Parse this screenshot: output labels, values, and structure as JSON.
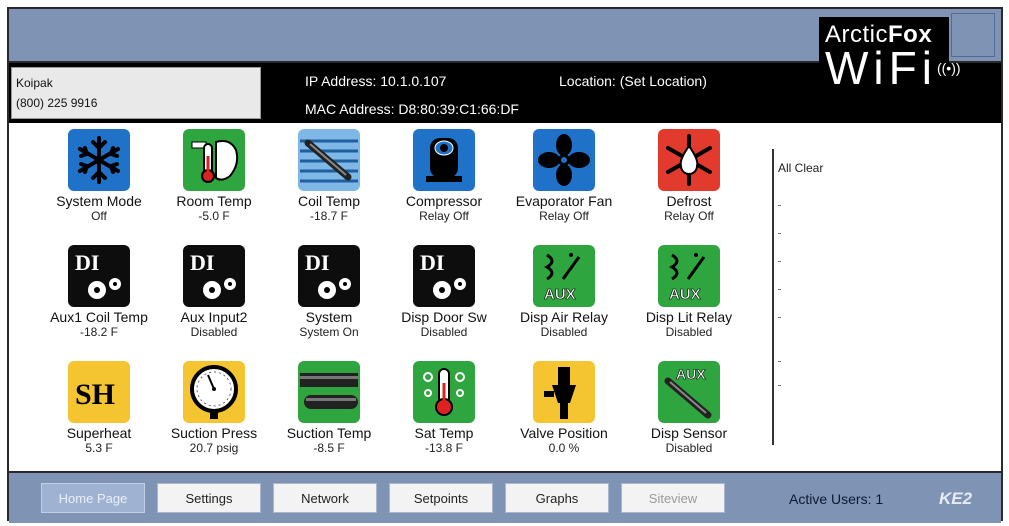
{
  "header": {
    "contact_name": "Koipak",
    "contact_phone": "(800) 225 9916",
    "ip_address": "IP Address: 10.1.0.107",
    "mac_address": "MAC Address: D8:80:39:C1:66:DF",
    "location": "Location: (Set Location)",
    "logo_arctic": "Arctic",
    "logo_fox": "Fox",
    "logo_wifi": "WiFi",
    "status_color": "#f6d90c"
  },
  "tiles": [
    {
      "label": "System Mode",
      "value": "Off",
      "icon": "snowflake-icon"
    },
    {
      "label": "Room Temp",
      "value": "-5.0 F",
      "icon": "room-thermometer-icon"
    },
    {
      "label": "Coil Temp",
      "value": "-18.7 F",
      "icon": "coil-sensor-icon"
    },
    {
      "label": "Compressor",
      "value": "Relay Off",
      "icon": "compressor-icon"
    },
    {
      "label": "Evaporator Fan",
      "value": "Relay Off",
      "icon": "fan-icon"
    },
    {
      "label": "Defrost",
      "value": "Relay Off",
      "icon": "defrost-icon"
    },
    {
      "label": "Aux1 Coil Temp",
      "value": "-18.2 F",
      "icon": "di-gear-icon"
    },
    {
      "label": "Aux Input2",
      "value": "Disabled",
      "icon": "di-gear-icon"
    },
    {
      "label": "System",
      "value": "System On",
      "icon": "di-gear-icon"
    },
    {
      "label": "Disp Door Sw",
      "value": "Disabled",
      "icon": "di-gear-icon"
    },
    {
      "label": "Disp Air Relay",
      "value": "Disabled",
      "icon": "aux-relay-icon"
    },
    {
      "label": "Disp Lit Relay",
      "value": "Disabled",
      "icon": "aux-relay-icon"
    },
    {
      "label": "Superheat",
      "value": "5.3 F",
      "icon": "superheat-icon"
    },
    {
      "label": "Suction Press",
      "value": "20.7 psig",
      "icon": "pressure-gauge-icon"
    },
    {
      "label": "Suction Temp",
      "value": "-8.5 F",
      "icon": "pipe-sensor-icon"
    },
    {
      "label": "Sat Temp",
      "value": "-13.8 F",
      "icon": "sat-thermometer-icon"
    },
    {
      "label": "Valve Position",
      "value": "0.0 %",
      "icon": "valve-icon"
    },
    {
      "label": "Disp Sensor",
      "value": "Disabled",
      "icon": "aux-sensor-icon"
    }
  ],
  "icon_text": {
    "di": "DI",
    "aux": "AUX",
    "sh": "SH"
  },
  "alarms": {
    "title": "All Clear"
  },
  "nav": {
    "items": [
      {
        "label": "Home Page",
        "state": "active"
      },
      {
        "label": "Settings",
        "state": "normal"
      },
      {
        "label": "Network",
        "state": "normal"
      },
      {
        "label": "Setpoints",
        "state": "normal"
      },
      {
        "label": "Graphs",
        "state": "normal"
      },
      {
        "label": "Siteview",
        "state": "disabled"
      }
    ],
    "active_users": "Active Users: 1",
    "brand": "KE2"
  }
}
